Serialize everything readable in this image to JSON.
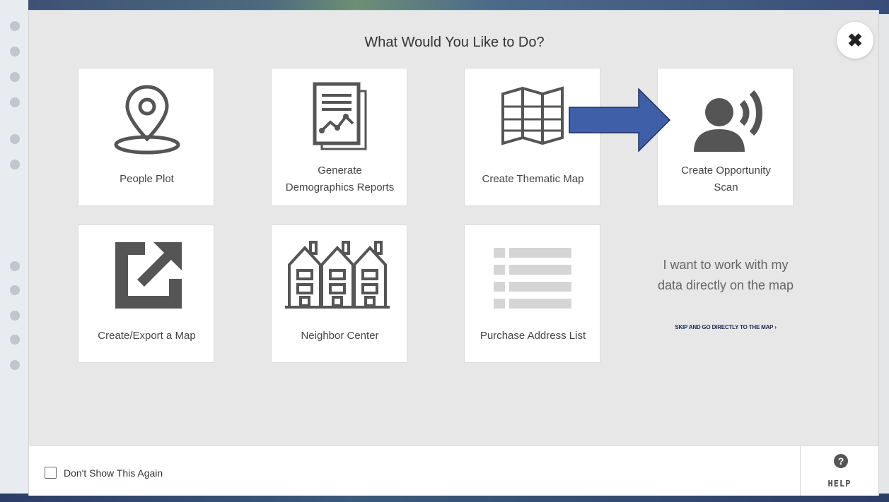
{
  "dialog": {
    "title": "What Would You Like to Do?",
    "close_icon": "✖"
  },
  "tiles": [
    {
      "label": "People Plot",
      "icon": "map-pin-icon"
    },
    {
      "label": "Generate\nDemographics Reports",
      "icon": "report-chart-icon"
    },
    {
      "label": "Create Thematic Map",
      "icon": "folded-map-icon"
    },
    {
      "label": "Create Opportunity\nScan",
      "icon": "person-broadcast-icon"
    },
    {
      "label": "Create/Export a Map",
      "icon": "export-icon"
    },
    {
      "label": "Neighbor Center",
      "icon": "houses-icon"
    },
    {
      "label": "Purchase Address List",
      "icon": "list-icon"
    }
  ],
  "side": {
    "text": "I want to work with my data directly on the map",
    "skip_link": "SKIP AND GO DIRECTLY TO THE MAP ›"
  },
  "footer": {
    "checkbox_label": "Don't Show This Again",
    "checkbox_checked": false,
    "help_label": "HELP",
    "help_icon": "?"
  },
  "colors": {
    "arrow": "#3f5fa8",
    "icon": "#555555",
    "modal_bg": "#e7e7e7"
  }
}
